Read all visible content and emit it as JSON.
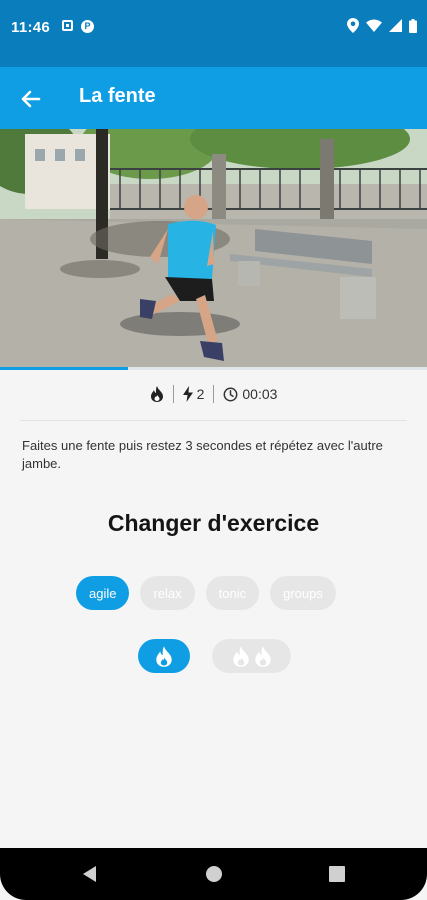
{
  "status": {
    "time": "11:46",
    "left_icons": [
      "notification-square-icon",
      "app-p-icon"
    ],
    "right_icons": [
      "location-icon",
      "wifi-icon",
      "signal-icon",
      "battery-icon"
    ],
    "p_glyph": "P"
  },
  "app_bar": {
    "title": "La fente",
    "back_icon": "arrow-left-icon"
  },
  "hero": {
    "description": "Man in a blue t-shirt doing a lunge on a park plaza"
  },
  "progress": {
    "value": 0.3
  },
  "stats": {
    "intensity_icon": "flame-icon",
    "energy_icon": "lightning-icon",
    "energy_value": "2",
    "time_icon": "clock-icon",
    "time_value": "00:03"
  },
  "description": "Faites une fente puis restez 3 secondes et répétez avec l'autre jambe.",
  "change_section": {
    "title": "Changer d'exercice",
    "categories": [
      {
        "label": "agile",
        "active": true
      },
      {
        "label": "relax",
        "active": false
      },
      {
        "label": "tonic",
        "active": false
      },
      {
        "label": "groups",
        "active": false
      }
    ],
    "levels": [
      {
        "flames": 1,
        "active": true
      },
      {
        "flames": 2,
        "active": false
      }
    ]
  },
  "colors": {
    "status_bar": "#0a7dbd",
    "app_bar": "#0f9ee3",
    "accent": "#0f9ee3",
    "chip_inactive": "#e6e6e6"
  },
  "nav": {
    "icons": [
      "back-triangle-icon",
      "home-circle-icon",
      "recents-square-icon"
    ]
  }
}
